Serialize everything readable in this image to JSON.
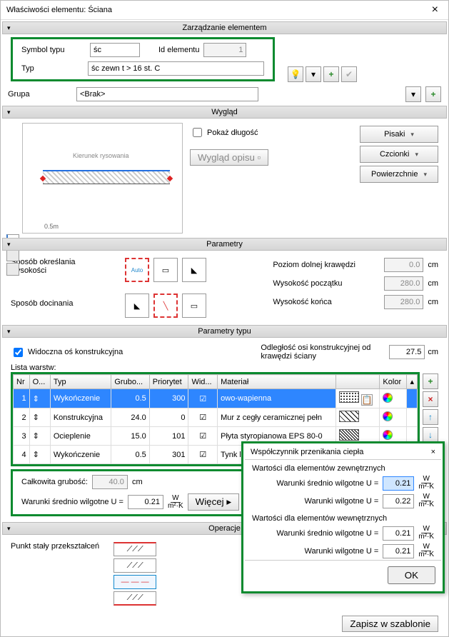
{
  "window_title": "Właściwości elementu: Ściana",
  "sections": {
    "management": "Zarządzanie elementem",
    "appearance": "Wygląd",
    "parameters": "Parametry",
    "type_params": "Parametry typu",
    "operations": "Operacje"
  },
  "mgmt": {
    "symbol_label": "Symbol typu",
    "symbol_value": "śc",
    "id_label": "Id elementu",
    "id_value": "1",
    "type_label": "Typ",
    "type_value": "śc zewn t > 16 st. C",
    "group_label": "Grupa",
    "group_value": "<Brak>"
  },
  "appearance": {
    "show_length": "Pokaż długość",
    "desc_look": "Wygląd opisu",
    "pens": "Pisaki",
    "fonts": "Czcionki",
    "surfaces": "Powierzchnie",
    "arrow_text": "Kierunek rysowania",
    "scale": "0.5m"
  },
  "parameters": {
    "height_method": "Sposób określania wysokości",
    "trim_method": "Sposób docinania",
    "lower_edge": "Poziom dolnej krawędzi",
    "lower_edge_val": "0.0",
    "start_height": "Wysokość początku",
    "start_height_val": "280.0",
    "end_height": "Wysokość końca",
    "end_height_val": "280.0",
    "unit_cm": "cm"
  },
  "type_params": {
    "show_axis": "Widoczna oś konstrukcyjna",
    "axis_dist": "Odległość osi konstrukcyjnej od krawędzi ściany",
    "axis_dist_val": "27.5",
    "unit_cm": "cm",
    "layers_label": "Lista warstw:",
    "cols": {
      "nr": "Nr",
      "o": "O...",
      "typ": "Typ",
      "grubo": "Grubo...",
      "priorytet": "Priorytet",
      "wid": "Wid...",
      "material": "Materiał",
      "kolor": "Kolor"
    },
    "rows": [
      {
        "nr": "1",
        "typ": "Wykończenie",
        "grubo": "0.5",
        "pri": "300",
        "mat": "owo-wapienna"
      },
      {
        "nr": "2",
        "typ": "Konstrukcyjna",
        "grubo": "24.0",
        "pri": "0",
        "mat": "Mur z cegły ceramicznej pełn"
      },
      {
        "nr": "3",
        "typ": "Ocieplenie",
        "grubo": "15.0",
        "pri": "101",
        "mat": "Płyta styropianowa EPS 80-0"
      },
      {
        "nr": "4",
        "typ": "Wykończenie",
        "grubo": "0.5",
        "pri": "301",
        "mat": "Tynk lub gładź cementowa"
      }
    ],
    "total_thick_label": "Całkowita grubość:",
    "total_thick_val": "40.0",
    "medium_humid_label": "Warunki średnio wilgotne U =",
    "medium_humid_val": "0.21",
    "more": "Więcej"
  },
  "operations": {
    "fixed_point": "Punkt stały przekształceń",
    "save_template": "Zapisz w szablonie"
  },
  "popup": {
    "title": "Współczynnik przenikania ciepła",
    "ext_section": "Wartości dla elementów zewnętrznych",
    "int_section": "Wartości dla elementów wewnętrznych",
    "medium_label": "Warunki średnio wilgotne U =",
    "wet_label": "Warunki wilgotne U =",
    "ext_medium": "0.21",
    "ext_wet": "0.22",
    "int_medium": "0.21",
    "int_wet": "0.21",
    "ok": "OK"
  }
}
